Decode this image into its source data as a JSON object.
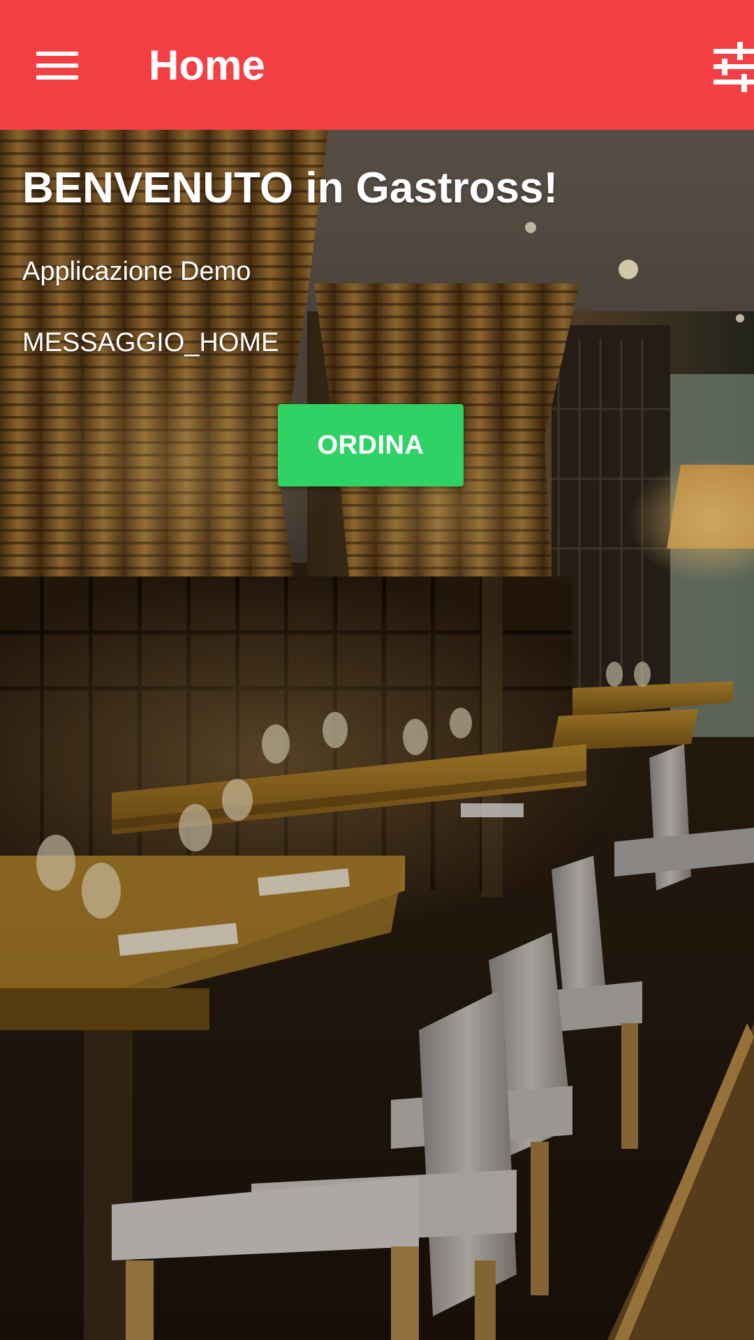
{
  "appbar": {
    "title": "Home",
    "menu_icon": "hamburger-menu-icon",
    "filter_icon": "tune-sliders-icon",
    "background_color": "#f43f45"
  },
  "hero": {
    "welcome_text": "BENVENUTO in Gastross!",
    "subtitle": "Applicazione Demo",
    "message": "MESSAGGIO_HOME",
    "background_image": "restaurant-interior-photo"
  },
  "actions": {
    "order_label": "ORDINA",
    "order_color": "#2fd265"
  }
}
